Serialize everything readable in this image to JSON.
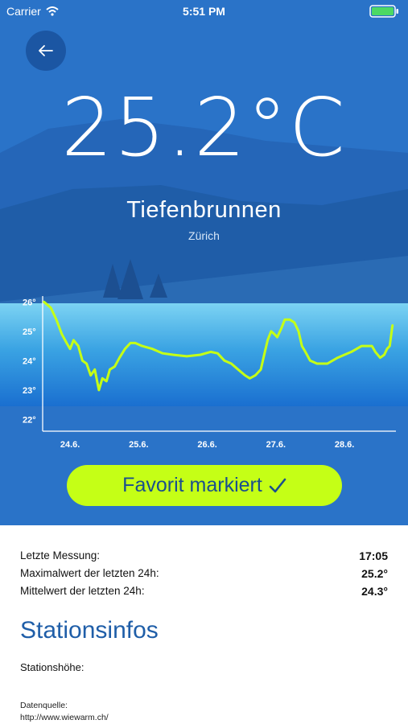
{
  "status_bar": {
    "carrier": "Carrier",
    "time": "5:51 PM"
  },
  "colors": {
    "accent": "#c5ff16",
    "hero_bg": "#2a73c8",
    "title_blue": "#1f5ea8"
  },
  "hero": {
    "back_icon": "arrow-left-icon",
    "temperature": "25.2°C",
    "station_name": "Tiefenbrunnen",
    "canton": "Zürich"
  },
  "chart_data": {
    "type": "line",
    "y_tick_labels": [
      "26°",
      "25°",
      "24°",
      "23°",
      "22°"
    ],
    "x_tick_labels": [
      "24.6.",
      "25.6.",
      "26.6.",
      "27.6.",
      "28.6."
    ],
    "ylim": [
      21.6,
      26.2
    ],
    "xlim": [
      23.6,
      28.75
    ],
    "grid": false,
    "series": [
      {
        "color": "#c5ff16",
        "points": [
          [
            23.62,
            26.0
          ],
          [
            23.72,
            25.8
          ],
          [
            23.8,
            25.4
          ],
          [
            23.88,
            24.9
          ],
          [
            23.95,
            24.6
          ],
          [
            24.0,
            24.4
          ],
          [
            24.05,
            24.7
          ],
          [
            24.12,
            24.5
          ],
          [
            24.18,
            24.0
          ],
          [
            24.24,
            23.9
          ],
          [
            24.3,
            23.5
          ],
          [
            24.36,
            23.7
          ],
          [
            24.42,
            23.0
          ],
          [
            24.47,
            23.4
          ],
          [
            24.53,
            23.3
          ],
          [
            24.58,
            23.7
          ],
          [
            24.65,
            23.8
          ],
          [
            24.72,
            24.1
          ],
          [
            24.8,
            24.4
          ],
          [
            24.88,
            24.6
          ],
          [
            24.95,
            24.6
          ],
          [
            25.05,
            24.5
          ],
          [
            25.2,
            24.4
          ],
          [
            25.35,
            24.25
          ],
          [
            25.5,
            24.2
          ],
          [
            25.7,
            24.15
          ],
          [
            25.9,
            24.2
          ],
          [
            26.05,
            24.3
          ],
          [
            26.15,
            24.25
          ],
          [
            26.25,
            24.0
          ],
          [
            26.35,
            23.9
          ],
          [
            26.45,
            23.7
          ],
          [
            26.55,
            23.5
          ],
          [
            26.62,
            23.4
          ],
          [
            26.7,
            23.5
          ],
          [
            26.78,
            23.7
          ],
          [
            26.83,
            24.2
          ],
          [
            26.88,
            24.7
          ],
          [
            26.93,
            25.0
          ],
          [
            26.98,
            24.9
          ],
          [
            27.02,
            24.8
          ],
          [
            27.08,
            25.1
          ],
          [
            27.13,
            25.4
          ],
          [
            27.2,
            25.4
          ],
          [
            27.27,
            25.3
          ],
          [
            27.33,
            25.0
          ],
          [
            27.38,
            24.5
          ],
          [
            27.43,
            24.3
          ],
          [
            27.5,
            24.0
          ],
          [
            27.6,
            23.9
          ],
          [
            27.75,
            23.9
          ],
          [
            27.9,
            24.1
          ],
          [
            28.0,
            24.2
          ],
          [
            28.1,
            24.3
          ],
          [
            28.25,
            24.5
          ],
          [
            28.4,
            24.5
          ],
          [
            28.45,
            24.3
          ],
          [
            28.52,
            24.1
          ],
          [
            28.58,
            24.2
          ],
          [
            28.62,
            24.4
          ],
          [
            28.66,
            24.5
          ],
          [
            28.7,
            25.2
          ]
        ]
      }
    ]
  },
  "favorite_button": {
    "label": "Favorit markiert",
    "icon": "checkmark-icon"
  },
  "measurements": [
    {
      "label": "Letzte Messung:",
      "value": "17:05"
    },
    {
      "label": "Maximalwert der letzten 24h:",
      "value": "25.2°"
    },
    {
      "label": "Mittelwert der letzten 24h:",
      "value": "24.3°"
    }
  ],
  "station_info": {
    "title": "Stationsinfos",
    "height_label": "Stationshöhe:",
    "source_label": "Datenquelle:",
    "source_url": "http://www.wiewarm.ch/"
  }
}
